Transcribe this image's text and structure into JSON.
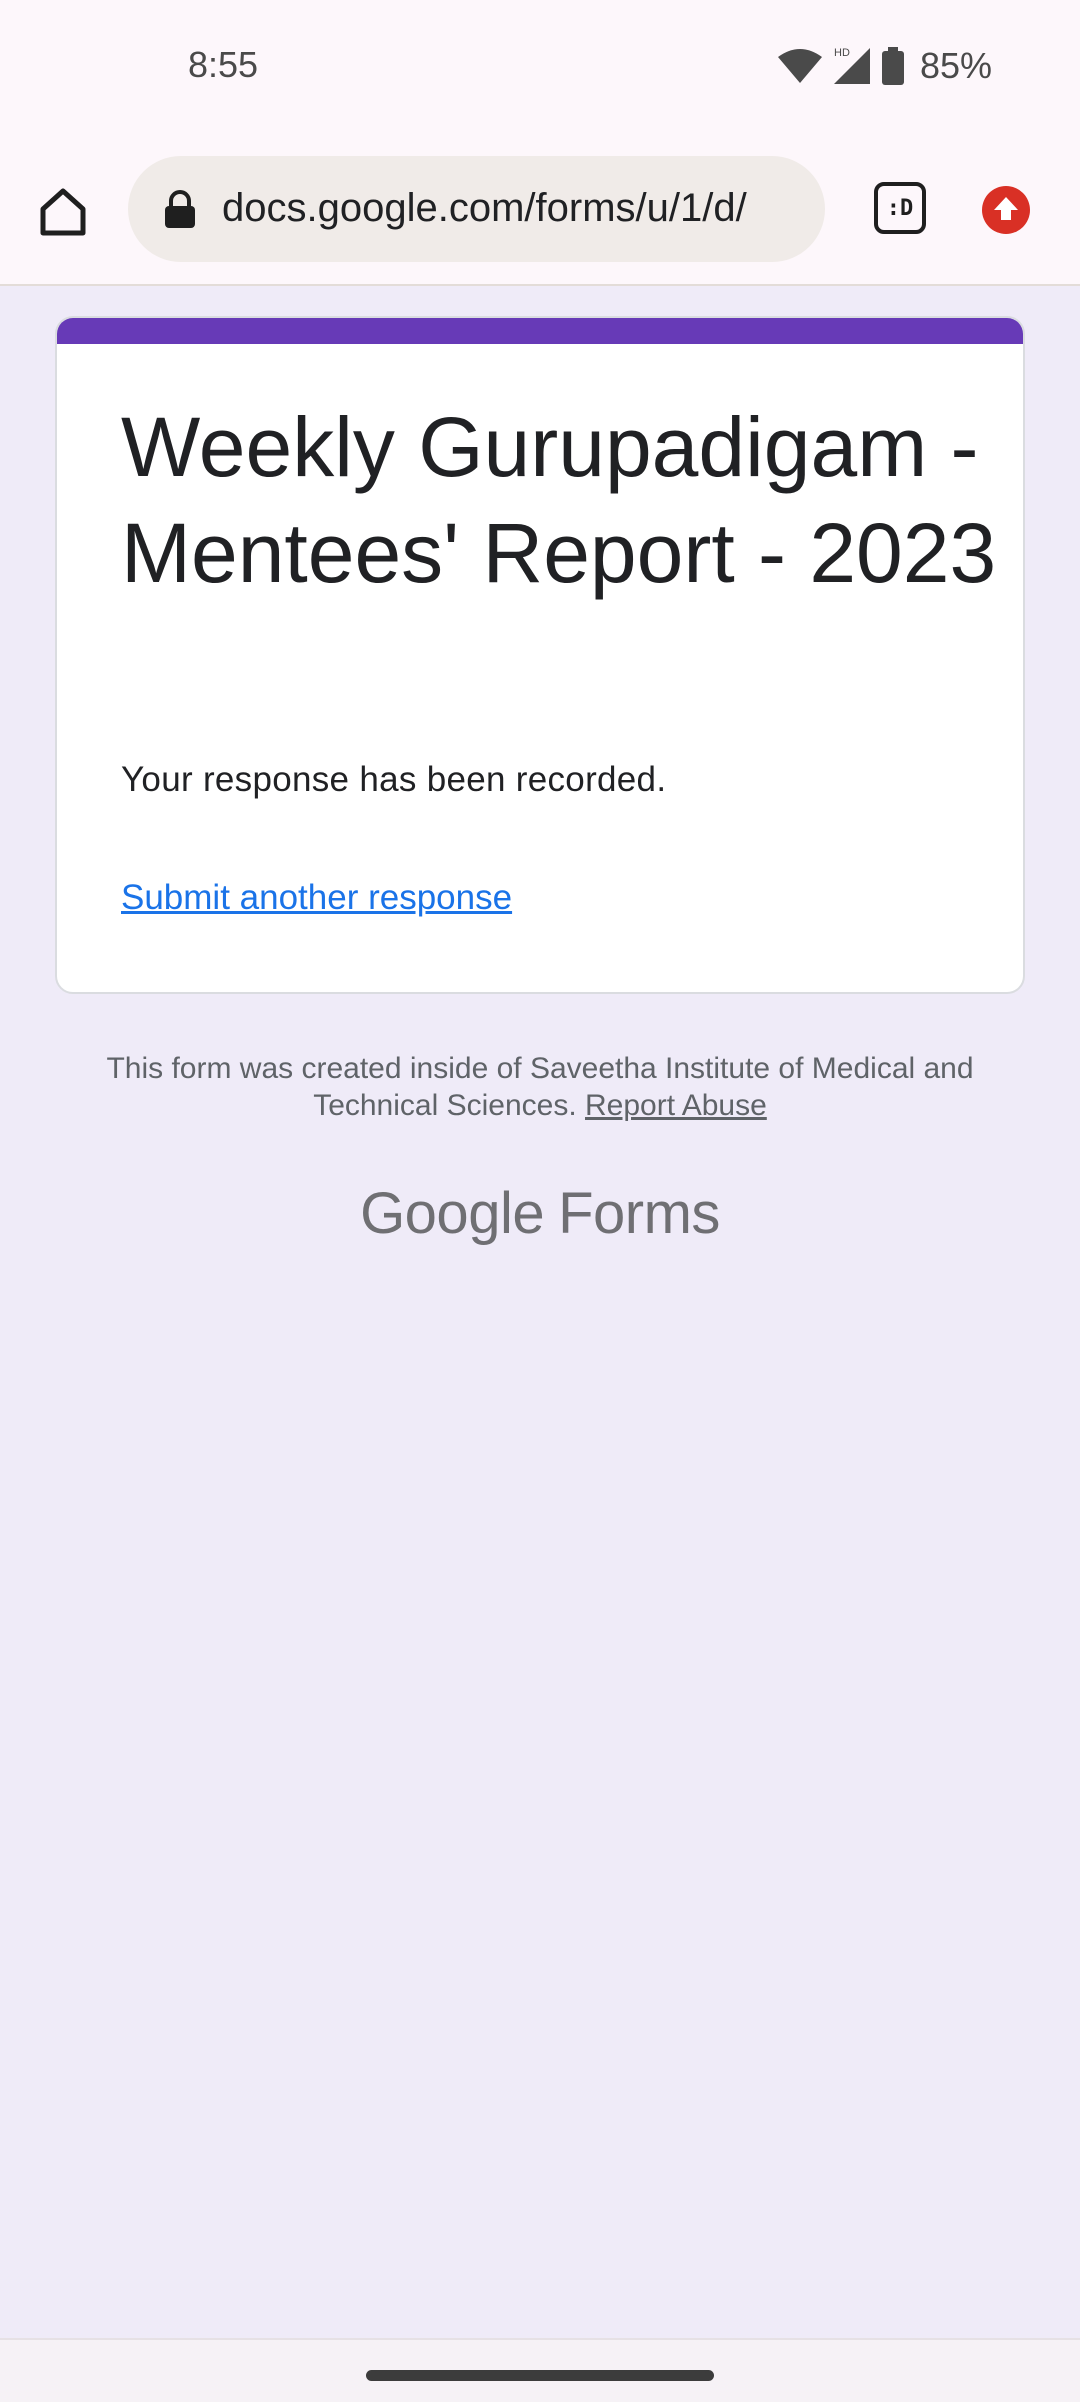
{
  "status_bar": {
    "time": "8:55",
    "battery_percent": "85%",
    "network_badge": "HD",
    "icons": [
      "wifi-icon",
      "signal-icon",
      "battery-icon"
    ]
  },
  "browser": {
    "url": "docs.google.com/forms/u/1/d/",
    "tab_switcher_label": ":D",
    "icons": [
      "home-icon",
      "lock-icon",
      "tab-switcher-icon",
      "update-icon"
    ]
  },
  "form": {
    "title": "Weekly Gurupadigam - Mentees' Report - 2023",
    "confirmation": "Your response has been recorded.",
    "submit_another": "Submit another response",
    "accent_color": "#673ab7"
  },
  "footer": {
    "note": "This form was created inside of Saveetha Institute of Medical and Technical Sciences.",
    "report_abuse": "Report Abuse",
    "brand_google": "Google",
    "brand_forms": "Forms"
  }
}
